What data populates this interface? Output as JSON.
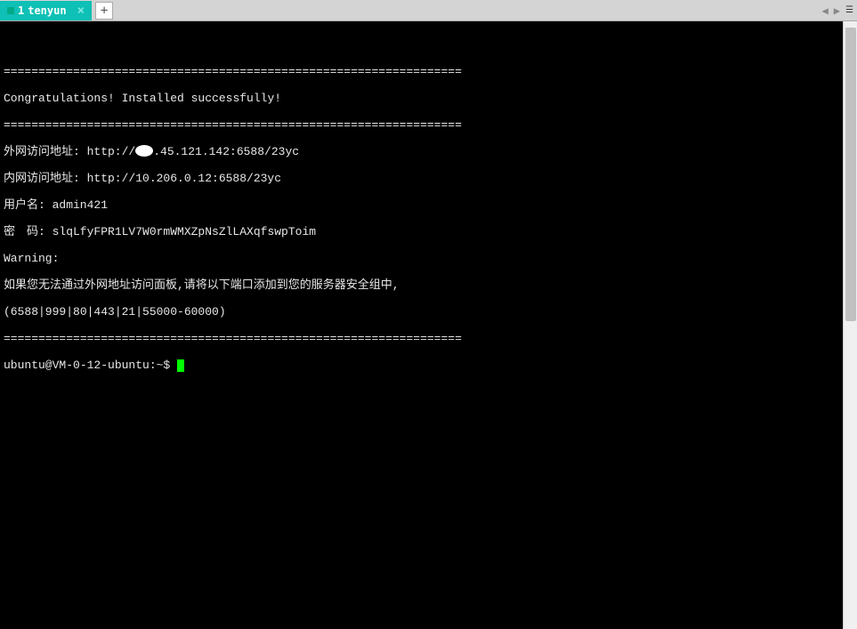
{
  "tabs": {
    "active": {
      "number": "1",
      "title": "tenyun",
      "close": "×"
    },
    "new_tab": "+"
  },
  "nav": {
    "prev": "◀",
    "next": "▶",
    "menu": "☰"
  },
  "terminal": {
    "separator1": "==================================================================",
    "congrats": "Congratulations! Installed successfully!",
    "separator2": "==================================================================",
    "line_ext_prefix": "外网访问地址: http://",
    "line_ext_suffix": ".45.121.142:6588/23yc",
    "line_int": "内网访问地址: http://10.206.0.12:6588/23yc",
    "line_user": "用户名: admin421",
    "line_pass": "密　码: slqLfyFPR1LV7W0rmWMXZpNsZlLAXqfswpToim",
    "line_warn": "Warning:",
    "line_warn2": "如果您无法通过外网地址访问面板,请将以下端口添加到您的服务器安全组中,",
    "line_ports": "(6588|999|80|443|21|55000-60000)",
    "separator3": "==================================================================",
    "prompt": "ubuntu@VM-0-12-ubuntu:~$ "
  }
}
